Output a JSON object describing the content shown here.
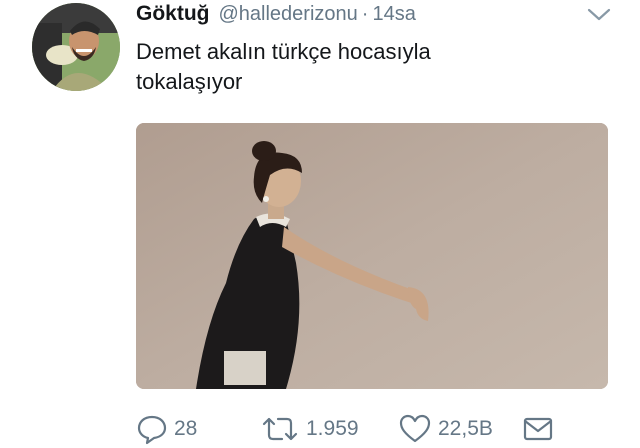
{
  "tweet": {
    "author_name": "Göktuğ",
    "handle": "@hallederizonu",
    "separator": "·",
    "time": "14sa",
    "text_line1": "Demet akalın türkçe hocasıyla",
    "text_line2": "tokalaşıyor"
  },
  "actions": {
    "reply_count": "28",
    "retweet_count": "1.959",
    "like_count": "22,5B"
  },
  "icons": {
    "caret": "chevron-down-icon",
    "reply": "speech-bubble-icon",
    "retweet": "retweet-icon",
    "like": "heart-icon",
    "dm": "envelope-icon"
  },
  "colors": {
    "text": "#14171a",
    "secondary": "#657786",
    "media_background": "#b9a79b"
  }
}
